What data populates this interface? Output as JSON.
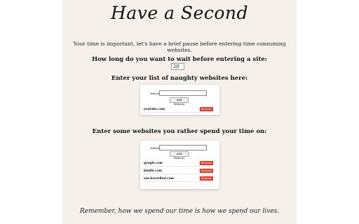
{
  "title": "Have a Second",
  "subtitle": "Your time is important, let's have a brief pause before entering time consuming websites.",
  "wait": {
    "question": "How long do you want to wait before entering a site:",
    "value": "20"
  },
  "naughty": {
    "heading": "Enter your list of naughty websites here:",
    "website_label": "Website",
    "add_label": "Add Website",
    "sites": [
      "youtube.com"
    ],
    "remove_label": "Remove"
  },
  "better": {
    "heading": "Enter some websites you rather spend your time on:",
    "website_label": "Website",
    "add_label": "Add Website",
    "sites": [
      "google.com",
      "kindle.com",
      "stackoverflow.com"
    ],
    "remove_label": "Remove"
  },
  "footer": "Remember, how we spend our time is how we spend our lives.",
  "colors": {
    "page_bg": "#f5f0ea",
    "remove_button": "#e53b2c"
  }
}
